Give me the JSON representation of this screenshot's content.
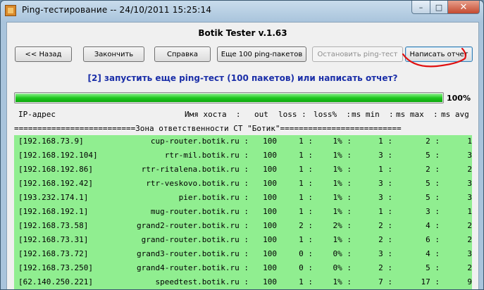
{
  "window": {
    "title": "Ping-тестирование -- 24/10/2011 15:25:14",
    "min_glyph": "–",
    "max_glyph": "□",
    "close_glyph": "✕"
  },
  "app": {
    "title": "Botik Tester v.1.63"
  },
  "buttons": [
    {
      "label": "<< Назад",
      "enabled": true
    },
    {
      "label": "Закончить",
      "enabled": true
    },
    {
      "label": "Справка",
      "enabled": true
    },
    {
      "label": "Еще 100 ping-пакетов",
      "enabled": true
    },
    {
      "label": "Остановить ping-тест",
      "enabled": false
    },
    {
      "label": "Написать отчет",
      "enabled": true
    }
  ],
  "prompt": "[2] запустить еще ping-тест (100 пакетов) или написать отчет?",
  "progress": {
    "value": 100,
    "label": "100%"
  },
  "table": {
    "headers": {
      "ip": "IP-адрес",
      "host": "Имя хоста  :",
      "out": "out",
      "loss": "loss :",
      "lossp": "loss%  :",
      "min": "ms min  :",
      "max": "ms max  :",
      "avg": "ms avg"
    },
    "zone_line": "==========================Зона ответственности СТ \"Ботик\"==========================",
    "rows": [
      {
        "ip": "[192.168.73.9]",
        "host": "cup-router.botik.ru :",
        "out": "100",
        "loss": "1 :",
        "lossp": "1% :",
        "min": "1 :",
        "max": "2 :",
        "avg": "1"
      },
      {
        "ip": "[192.168.192.104]",
        "host": "rtr-mil.botik.ru :",
        "out": "100",
        "loss": "1 :",
        "lossp": "1% :",
        "min": "3 :",
        "max": "5 :",
        "avg": "3"
      },
      {
        "ip": "[192.168.192.86]",
        "host": "rtr-ritalena.botik.ru :",
        "out": "100",
        "loss": "1 :",
        "lossp": "1% :",
        "min": "1 :",
        "max": "2 :",
        "avg": "2"
      },
      {
        "ip": "[192.168.192.42]",
        "host": "rtr-veskovo.botik.ru :",
        "out": "100",
        "loss": "1 :",
        "lossp": "1% :",
        "min": "3 :",
        "max": "5 :",
        "avg": "3"
      },
      {
        "ip": "[193.232.174.1]",
        "host": "pier.botik.ru :",
        "out": "100",
        "loss": "1 :",
        "lossp": "1% :",
        "min": "3 :",
        "max": "5 :",
        "avg": "3"
      },
      {
        "ip": "[192.168.192.1]",
        "host": "mug-router.botik.ru :",
        "out": "100",
        "loss": "1 :",
        "lossp": "1% :",
        "min": "1 :",
        "max": "3 :",
        "avg": "1"
      },
      {
        "ip": "[192.168.73.58]",
        "host": "grand2-router.botik.ru :",
        "out": "100",
        "loss": "2 :",
        "lossp": "2% :",
        "min": "2 :",
        "max": "4 :",
        "avg": "2"
      },
      {
        "ip": "[192.168.73.31]",
        "host": "grand-router.botik.ru :",
        "out": "100",
        "loss": "1 :",
        "lossp": "1% :",
        "min": "2 :",
        "max": "6 :",
        "avg": "2"
      },
      {
        "ip": "[192.168.73.72]",
        "host": "grand3-router.botik.ru :",
        "out": "100",
        "loss": "0 :",
        "lossp": "0% :",
        "min": "3 :",
        "max": "4 :",
        "avg": "3"
      },
      {
        "ip": "[192.168.73.250]",
        "host": "grand4-router.botik.ru :",
        "out": "100",
        "loss": "0 :",
        "lossp": "0% :",
        "min": "2 :",
        "max": "5 :",
        "avg": "2"
      },
      {
        "ip": "[62.140.250.221]",
        "host": "speedtest.botik.ru :",
        "out": "100",
        "loss": "1 :",
        "lossp": "1% :",
        "min": "7 :",
        "max": "17 :",
        "avg": "9"
      }
    ]
  },
  "colors": {
    "row_bg": "#90ee90",
    "prompt": "#1a2ea8",
    "progress": "#1fc71f",
    "annotation": "#e01010"
  }
}
